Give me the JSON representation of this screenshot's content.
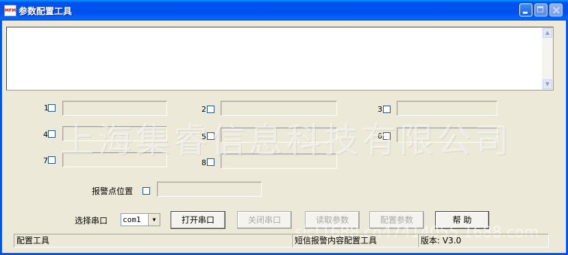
{
  "window": {
    "title": "参数配置工具",
    "icon_text": "MFM"
  },
  "checkboxes": [
    {
      "label": "1"
    },
    {
      "label": "2"
    },
    {
      "label": "3"
    },
    {
      "label": "4"
    },
    {
      "label": "5"
    },
    {
      "label": "6"
    },
    {
      "label": "7"
    },
    {
      "label": "8"
    }
  ],
  "alarm_position": {
    "label": "报警点位置"
  },
  "serial": {
    "label": "选择串口",
    "port_value": "com1"
  },
  "buttons": {
    "open_port": "打开串口",
    "close_port": "关闭串口",
    "read_params": "读取参数",
    "config_params": "配置参数",
    "help": "帮  助"
  },
  "statusbar": {
    "panel1": "配置工具",
    "panel2": "短信报警内容配置工具",
    "panel3": "版本: V3.0"
  },
  "watermarks": {
    "company": "上海集睿信息科技有限公司",
    "site": "sjct1688.cn47414055.1688.com"
  }
}
